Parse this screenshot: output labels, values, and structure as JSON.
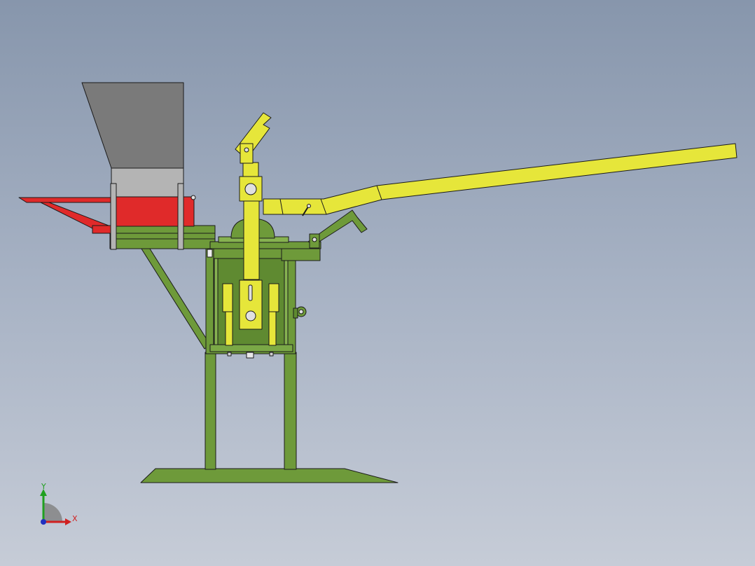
{
  "viewport": {
    "background_top": "#8796ac",
    "background_bottom": "#c6ccd7"
  },
  "colors": {
    "frame_green": "#6e9a3a",
    "frame_green_dark": "#4f7426",
    "lever_yellow": "#e6e63a",
    "hopper_gray": "#7a7a7a",
    "hopper_light": "#b4b4b4",
    "tray_red": "#e02a2a",
    "outline": "#1a1a1a"
  },
  "triad": {
    "x_label": "X",
    "y_label": "Y",
    "x_color": "#d02020",
    "y_color": "#20a020",
    "z_color": "#2030c0"
  }
}
